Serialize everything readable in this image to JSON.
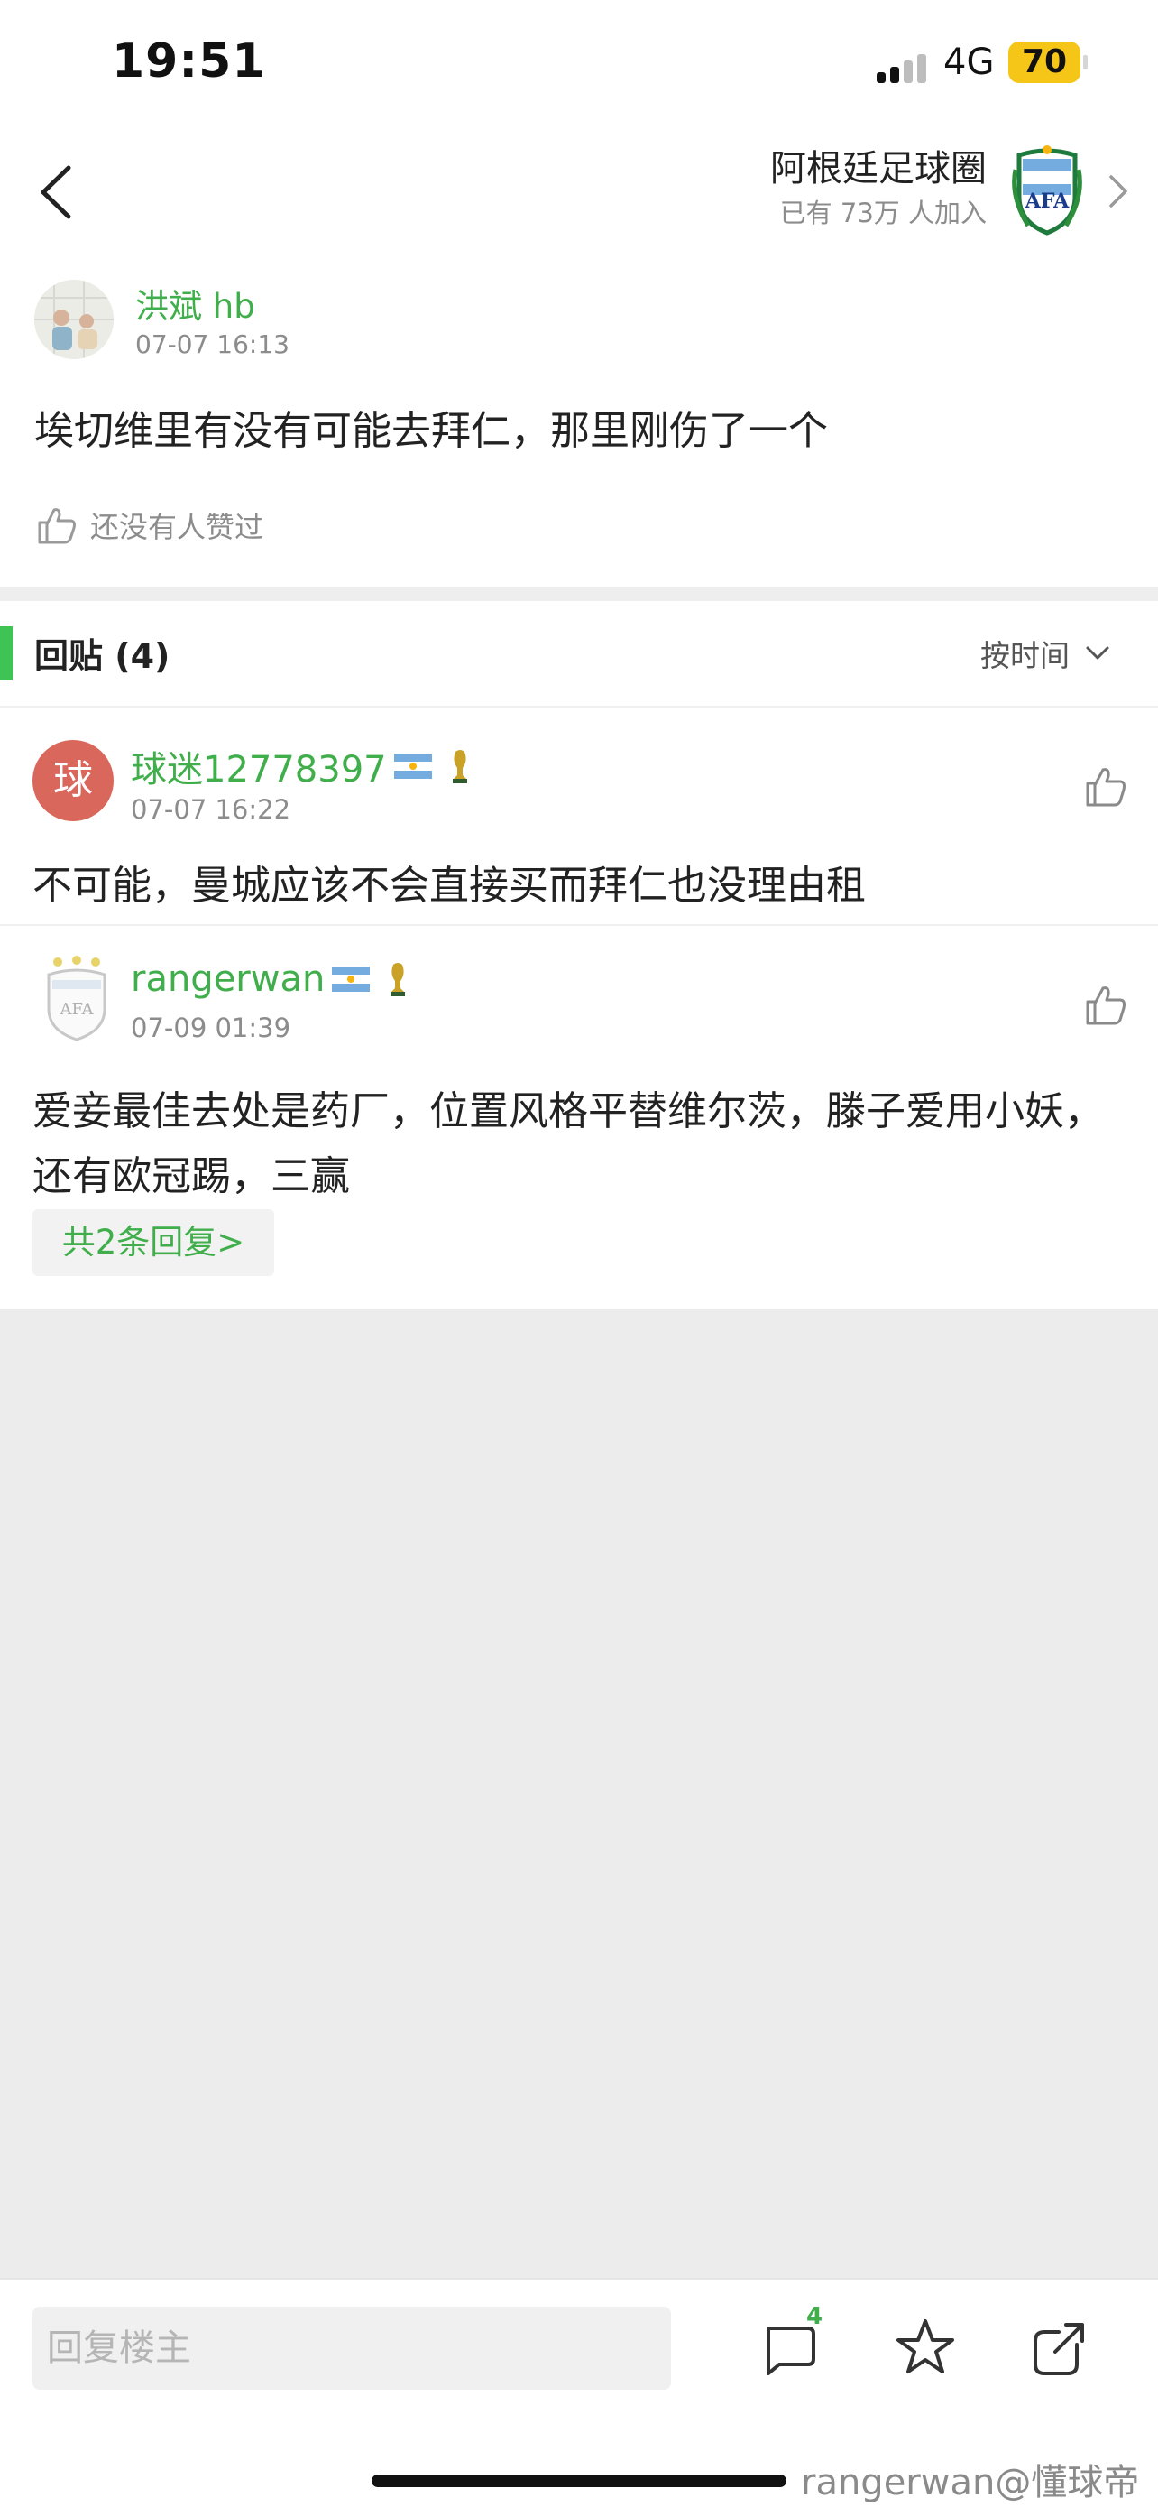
{
  "status_bar": {
    "time": "19:51",
    "network": "4G",
    "battery": "70"
  },
  "nav": {
    "circle_name": "阿根廷足球圈",
    "circle_members": "已有 73万 人加入"
  },
  "post": {
    "author": "洪斌 hb",
    "time": "07-07 16:13",
    "body": "埃切维里有没有可能去拜仁，那里刚伤了一个",
    "like_text": "还没有人赞过"
  },
  "replies": {
    "title": "回贴 (4)",
    "sort_label": "按时间",
    "items": [
      {
        "avatar_letter": "球",
        "name": "球迷12778397",
        "time": "07-07 16:22",
        "body": "不可能，曼城应该不会直接买而拜仁也没理由租"
      },
      {
        "name": "rangerwan",
        "time": "07-09 01:39",
        "body": "爱妾最佳去处是药厂，位置风格平替维尔茨，滕子爱用小妖，还有欧冠踢，三赢",
        "more_replies": "共2条回复>"
      }
    ]
  },
  "bottom_bar": {
    "reply_placeholder": "回复楼主",
    "comment_count": "4",
    "watermark": "rangerwan@懂球帝"
  },
  "colors": {
    "accent_green": "#3fae4b",
    "battery_yellow": "#f5c518",
    "avatar_red": "#d9675c"
  }
}
